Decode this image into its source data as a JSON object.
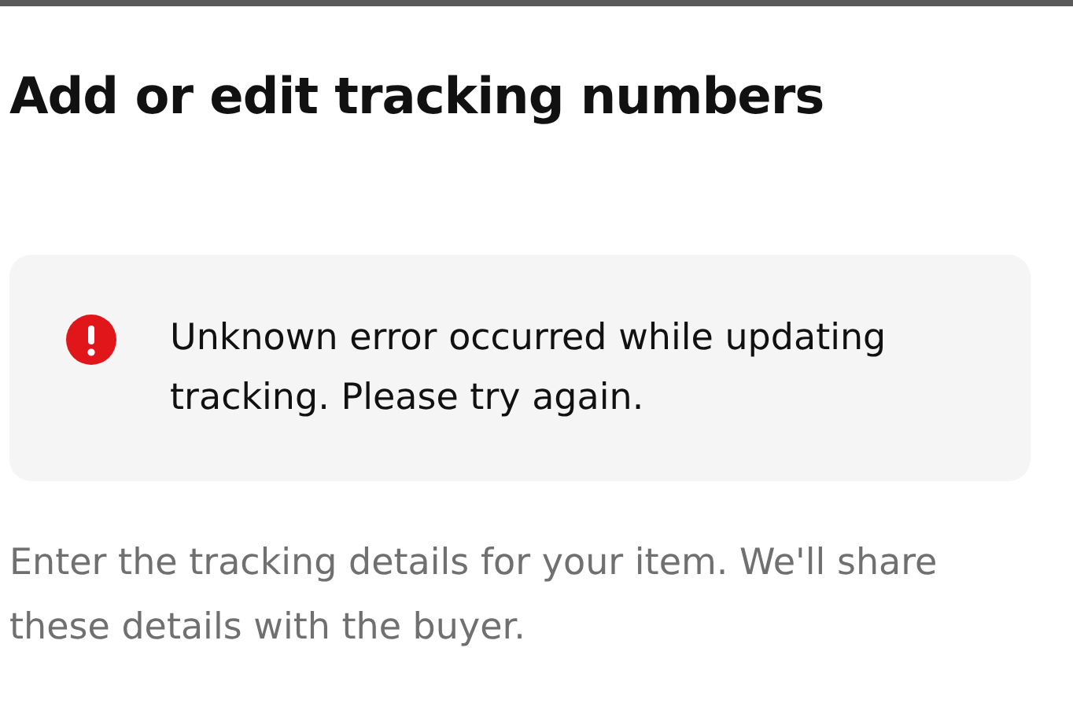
{
  "title": "Add or edit tracking numbers",
  "alert": {
    "kind": "error",
    "message": "Unknown error occurred while updating tracking. Please try again."
  },
  "description": "Enter the tracking details for your item. We'll share these details with the buyer."
}
